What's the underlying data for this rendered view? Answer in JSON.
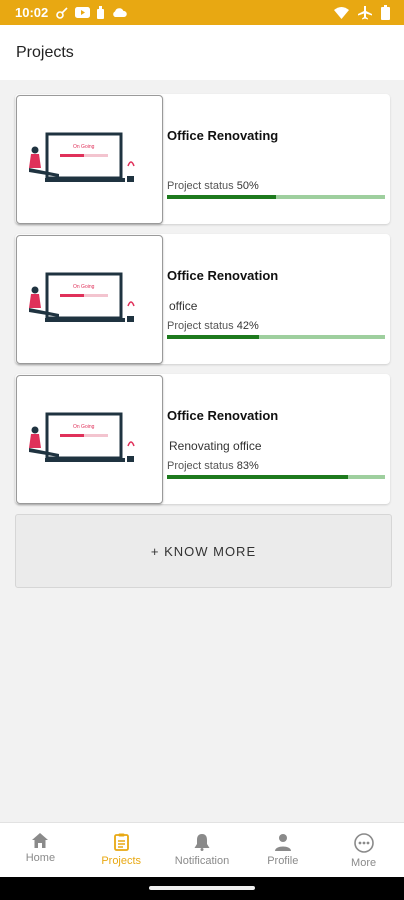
{
  "status_bar": {
    "time": "10:02",
    "left_icons": [
      "key-icon",
      "youtube-icon",
      "bottle-icon",
      "cloud-icon"
    ],
    "right_icons": [
      "wifi-icon",
      "airplane-icon",
      "battery-icon"
    ],
    "background": "#e8a812"
  },
  "app_bar": {
    "title": "Projects"
  },
  "projects": [
    {
      "name": "Office Renovating",
      "description": "",
      "status_label": "Project status",
      "status_value": "50%",
      "progress": 0.5,
      "image_text": "On Going"
    },
    {
      "name": "Office Renovation",
      "description": "office",
      "status_label": "Project status",
      "status_value": "42%",
      "progress": 0.42,
      "image_text": "On Going"
    },
    {
      "name": "Office Renovation",
      "description": "Renovating office",
      "status_label": "Project status",
      "status_value": "83%",
      "progress": 0.83,
      "image_text": "On Going"
    }
  ],
  "know_more": {
    "label": "+ KNOW MORE"
  },
  "bottom_nav": [
    {
      "label": "Home",
      "icon": "home-icon",
      "active": false
    },
    {
      "label": "Projects",
      "icon": "clipboard-icon",
      "active": true
    },
    {
      "label": "Notification",
      "icon": "bell-icon",
      "active": false
    },
    {
      "label": "Profile",
      "icon": "person-icon",
      "active": false
    },
    {
      "label": "More",
      "icon": "more-icon",
      "active": false
    }
  ],
  "colors": {
    "accent": "#e8a812",
    "progress_fill": "#1d7a1d",
    "progress_track": "#9ecf9e"
  }
}
